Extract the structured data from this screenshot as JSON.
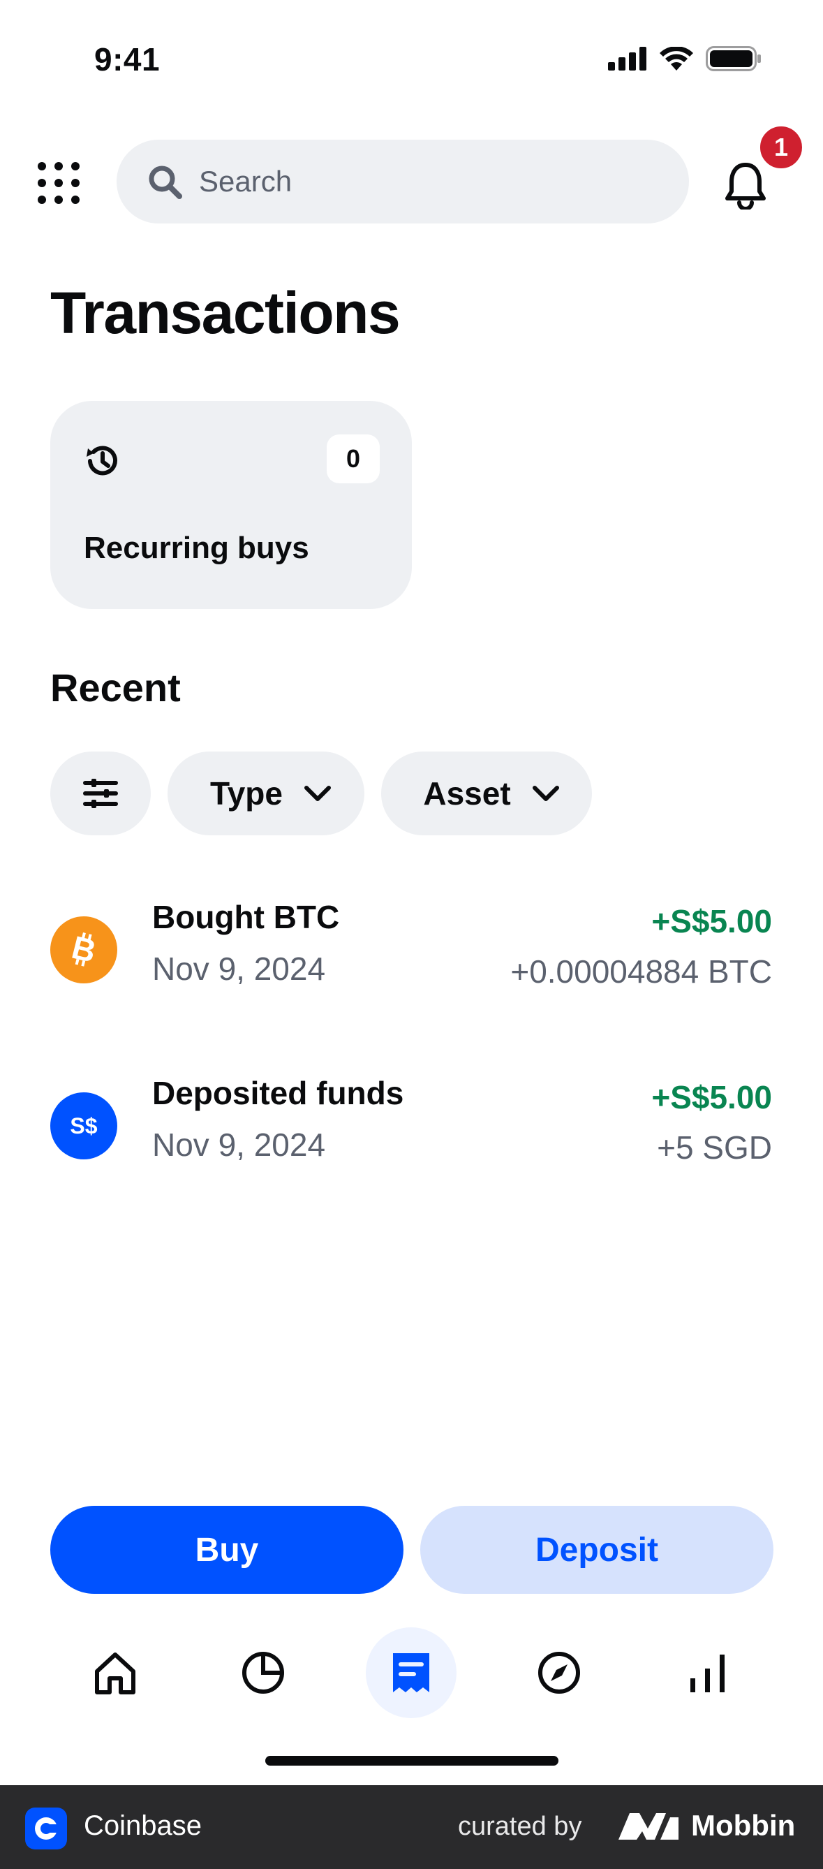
{
  "status_bar": {
    "time": "9:41"
  },
  "header": {
    "search_placeholder": "Search",
    "notification_count": "1"
  },
  "page_title": "Transactions",
  "recurring": {
    "label": "Recurring buys",
    "count": "0"
  },
  "recent": {
    "title": "Recent",
    "filters": {
      "type_label": "Type",
      "asset_label": "Asset"
    },
    "transactions": [
      {
        "title": "Bought BTC",
        "date": "Nov 9, 2024",
        "amount": "+S$5.00",
        "sub": "+0.00004884 BTC",
        "icon": "bitcoin-icon",
        "icon_color": "#f7931a"
      },
      {
        "title": "Deposited funds",
        "date": "Nov 9, 2024",
        "amount": "+S$5.00",
        "sub": "+5 SGD",
        "icon": "sgd-icon",
        "icon_text": "S$",
        "icon_color": "#0052ff"
      }
    ]
  },
  "actions": {
    "buy_label": "Buy",
    "deposit_label": "Deposit"
  },
  "tabbar": {
    "items": [
      "home-icon",
      "portfolio-icon",
      "transactions-icon",
      "explore-icon",
      "markets-icon"
    ],
    "active": "transactions-icon"
  },
  "footer": {
    "app_name": "Coinbase",
    "curated_by": "curated by",
    "brand": "Mobbin"
  },
  "colors": {
    "accent": "#0052ff",
    "positive": "#098551",
    "badge": "#cf202f",
    "chip_bg": "#eef0f3"
  }
}
